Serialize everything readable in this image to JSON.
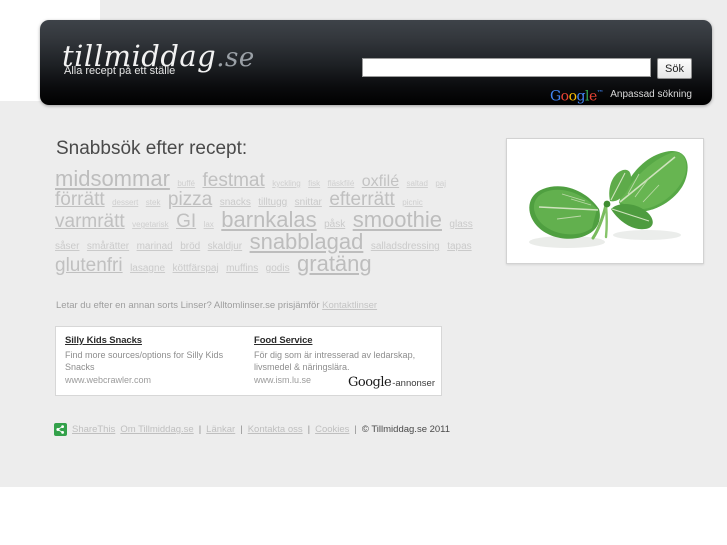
{
  "header": {
    "logo_main": "tillmiddag",
    "logo_suffix": ".se",
    "tagline": "Alla recept på ett ställe",
    "search": {
      "value": "",
      "placeholder": "",
      "button_label": "Sök"
    },
    "branding": {
      "google_g": "G",
      "google_o1": "o",
      "google_o2": "o",
      "google_g2": "g",
      "google_l": "l",
      "google_e": "e",
      "trademark": "™",
      "text": "Anpassad sökning"
    }
  },
  "main": {
    "headline": "Snabbsök efter recept:",
    "tags": [
      {
        "label": "midsommar",
        "size": 6
      },
      {
        "label": "buffé",
        "size": 1
      },
      {
        "label": "festmat",
        "size": 5
      },
      {
        "label": "kyckling",
        "size": 1
      },
      {
        "label": "fisk",
        "size": 1
      },
      {
        "label": "fläskfilé",
        "size": 1
      },
      {
        "label": "oxfilé",
        "size": 4
      },
      {
        "label": "saltad",
        "size": 1
      },
      {
        "label": "paj",
        "size": 1
      },
      {
        "label": "förrätt",
        "size": 5
      },
      {
        "label": "dessert",
        "size": 1
      },
      {
        "label": "stek",
        "size": 1
      },
      {
        "label": "pizza",
        "size": 5
      },
      {
        "label": "snacks",
        "size": 2
      },
      {
        "label": "tilltugg",
        "size": 2
      },
      {
        "label": "snittar",
        "size": 2
      },
      {
        "label": "efterrätt",
        "size": 5
      },
      {
        "label": "picnic",
        "size": 1
      },
      {
        "label": "varmrätt",
        "size": 5
      },
      {
        "label": "vegetarisk",
        "size": 1
      },
      {
        "label": "GI",
        "size": 5
      },
      {
        "label": "lax",
        "size": 1
      },
      {
        "label": "barnkalas",
        "size": 6
      },
      {
        "label": "påsk",
        "size": 2
      },
      {
        "label": "smoothie",
        "size": 6
      },
      {
        "label": "glass",
        "size": 2
      },
      {
        "label": "såser",
        "size": 2
      },
      {
        "label": "smårätter",
        "size": 2
      },
      {
        "label": "marinad",
        "size": 2
      },
      {
        "label": "bröd",
        "size": 2
      },
      {
        "label": "skaldjur",
        "size": 2
      },
      {
        "label": "snabblagad",
        "size": 6
      },
      {
        "label": "salladsdressing",
        "size": 2
      },
      {
        "label": "tapas",
        "size": 2
      },
      {
        "label": "glutenfri",
        "size": 5
      },
      {
        "label": "lasagne",
        "size": 2
      },
      {
        "label": "köttfärspaj",
        "size": 2
      },
      {
        "label": "muffins",
        "size": 2
      },
      {
        "label": "godis",
        "size": 2
      },
      {
        "label": "gratäng",
        "size": 6
      }
    ],
    "linser_text": "Letar du efter en annan sorts Linser? Alltomlinser.se prisjämför ",
    "linser_link": "Kontaktlinser",
    "hero_image_alt": "basilika-blad"
  },
  "ads": {
    "left": {
      "title": "Silly Kids Snacks",
      "description": "Find more sources/options for Silly Kids Snacks",
      "url": "www.webcrawler.com"
    },
    "right": {
      "title": "Food Service",
      "description": "För dig som är intresserad av ledarskap, livsmedel & näringslära.",
      "url": "www.ism.lu.se"
    },
    "brand_suffix": "-annonser"
  },
  "footer": {
    "share_label": "ShareThis",
    "links": [
      "Om Tillmiddag.se",
      "Länkar",
      "Kontakta oss",
      "Cookies"
    ],
    "separator": "|",
    "copyright": "© Tillmiddag.se 2011"
  },
  "colors": {
    "header_dark": "#16181b",
    "page_gray": "#ededed",
    "tag_gray": "#c4c4c4",
    "share_green": "#33a14a"
  }
}
